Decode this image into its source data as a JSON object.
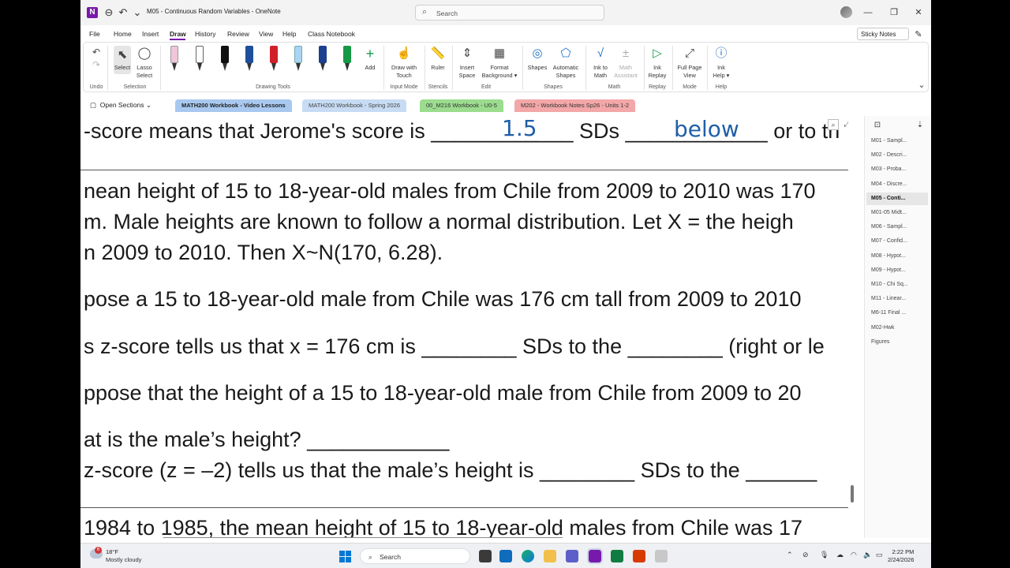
{
  "window": {
    "title": "M05 - Continuous Random Variables  -  OneNote",
    "search_placeholder": "Search"
  },
  "menu": [
    "File",
    "Home",
    "Insert",
    "Draw",
    "History",
    "Review",
    "View",
    "Help",
    "Class Notebook"
  ],
  "sticky_notes": "Sticky Notes",
  "ribbon": {
    "undo_label": "Undo",
    "select_label": "Select",
    "lasso_label": "Lasso\nSelect",
    "selection_group": "Selection",
    "drawing_tools_group": "Drawing Tools",
    "add_label": "Add",
    "draw_touch": "Draw with\nTouch",
    "input_mode_group": "Input Mode",
    "ruler": "Ruler",
    "stencils_group": "Stencils",
    "insert_space": "Insert\nSpace",
    "format_background": "Format\nBackground ▾",
    "edit_group": "Edit",
    "shapes": "Shapes",
    "automatic_shapes": "Automatic\nShapes",
    "shapes_group": "Shapes",
    "ink_to_math": "Ink to\nMath",
    "math_assistant": "Math\nAssistant",
    "math_group": "Math",
    "ink_replay": "Ink\nReplay",
    "replay_group": "Replay",
    "full_page": "Full Page\nView",
    "mode_group": "Mode",
    "ink_help": "Ink\nHelp ▾",
    "help_group": "Help",
    "pen_colors": [
      "#f1c6da",
      "#ffffff",
      "#111111",
      "#1f4e9c",
      "#d0212a",
      "#a9d4f5",
      "#1c3f8f",
      "#159947"
    ]
  },
  "sections": {
    "open_sections": "Open Sections",
    "tabs": [
      {
        "label": "MATH200 Workbook - Video Lessons",
        "color": "#a8c8ef"
      },
      {
        "label": "MATH200 Workbook - Spring 2026",
        "color": "#c7dcf4"
      },
      {
        "label": "00_M216 Workbook - U0-5",
        "color": "#9bdc8e"
      },
      {
        "label": "M202 - Workbook Notes Sp26 - Units 1-2",
        "color": "#f3a7a8"
      }
    ]
  },
  "content": {
    "line1_a": "-score means that Jerome's score is ____________ SDs ____________ or to th",
    "ink1": "1.5",
    "ink2": "below",
    "line2": "nean height of 15 to 18-year-old males from Chile from 2009 to 2010 was 170",
    "line3": "m. Male heights are known to follow a normal distribution. Let X = the heigh",
    "line4": "n 2009 to 2010. Then X~N(170, 6.28).",
    "line5": "pose a 15 to 18-year-old male from Chile was 176 cm tall from 2009 to 2010",
    "line6": "s z-score tells us that x = 176 cm is ________ SDs to the ________ (right or le",
    "line7": "ppose that the height of a 15 to 18-year-old male from Chile from 2009 to 20",
    "line8": "at is the male’s height? ____________",
    "line9": " z-score (z = –2) tells us that the male’s height is ________ SDs to the ______",
    "line10": "1984 to 1985, the mean height of 15 to 18-year-old males from Chile was 17"
  },
  "pages": [
    "M01 - Sampl...",
    "M02 - Descri...",
    "M03 - Proba...",
    "M04 - Discre...",
    "M05 - Conti...",
    "M01-05 Midt...",
    "M06 - Sampl...",
    "M07 - Confid...",
    "M08 - Hypot...",
    "M09 - Hypot...",
    "M10 - Chi Sq...",
    "M11 - Linear...",
    "M6-11 Final ...",
    "M02-Hwk",
    "Figures"
  ],
  "active_page_index": 4,
  "taskbar": {
    "temp": "18°F",
    "weather": "Mostly cloudy",
    "search": "Search",
    "time": "2:22 PM",
    "date": "2/24/2026"
  }
}
